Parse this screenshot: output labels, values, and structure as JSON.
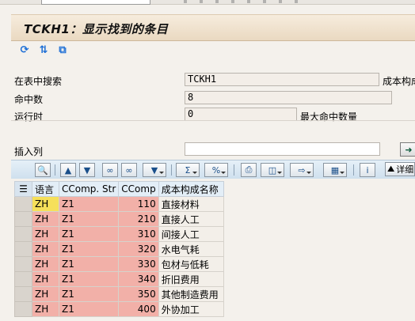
{
  "title": "TCKH1：显示找到的条目",
  "app_toolbar": {
    "icons": [
      "refresh-icon",
      "sort-icon",
      "detail-icon"
    ]
  },
  "form": {
    "search_table": {
      "label": "在表中搜索",
      "value": "TCKH1",
      "trailing": "成本构成"
    },
    "hits": {
      "label": "命中数",
      "value": "8"
    },
    "runtime": {
      "label": "运行时",
      "value": "0",
      "trailing": "最大命中数量"
    },
    "insert_column": {
      "label": "插入列",
      "value": ""
    }
  },
  "grid_toolbar": {
    "detail_label": "详细"
  },
  "grid": {
    "columns": [
      "语言",
      "CComp. Str",
      "CComp",
      "成本构成名称"
    ],
    "rows": [
      [
        "ZH",
        "Z1",
        "110",
        "直接材料"
      ],
      [
        "ZH",
        "Z1",
        "210",
        "直接人工"
      ],
      [
        "ZH",
        "Z1",
        "310",
        "间接人工"
      ],
      [
        "ZH",
        "Z1",
        "320",
        "水电气耗"
      ],
      [
        "ZH",
        "Z1",
        "330",
        "包材与低耗"
      ],
      [
        "ZH",
        "Z1",
        "340",
        "折旧费用"
      ],
      [
        "ZH",
        "Z1",
        "350",
        "其他制造费用"
      ],
      [
        "ZH",
        "Z1",
        "400",
        "外协加工"
      ]
    ]
  }
}
